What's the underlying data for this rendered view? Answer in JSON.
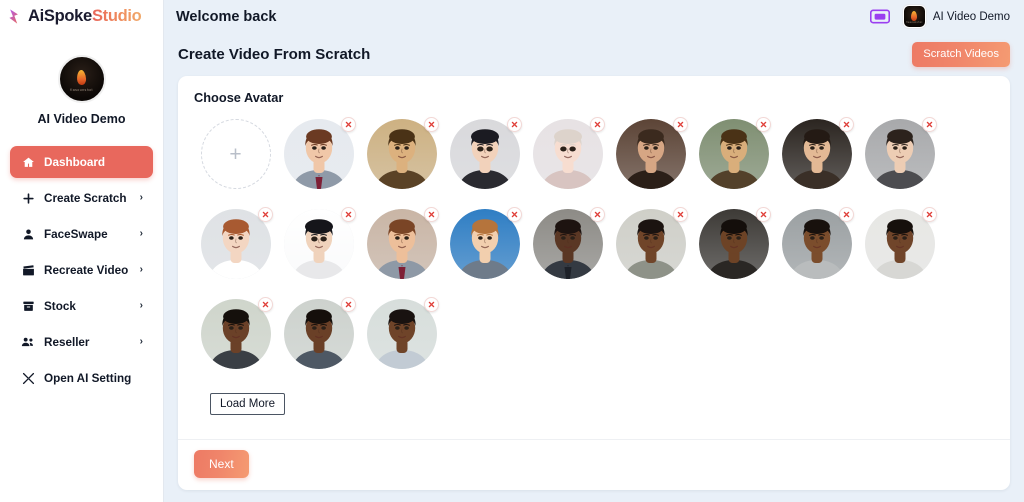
{
  "brand": {
    "ai": "Ai",
    "spoke": "Spoke",
    "studio": "Studio",
    "logo_icon": "play-bolt-icon"
  },
  "sidebar": {
    "profile": {
      "name": "AI Video Demo",
      "avatar_icon": "flame-avatar",
      "avatar_caption": "flasounshot"
    },
    "items": [
      {
        "label": "Dashboard",
        "icon": "home-icon",
        "active": true,
        "chevron": ""
      },
      {
        "label": "Create Scratch",
        "icon": "plus-icon",
        "active": false,
        "chevron": "›"
      },
      {
        "label": "FaceSwape",
        "icon": "person-icon",
        "active": false,
        "chevron": "›"
      },
      {
        "label": "Recreate Video",
        "icon": "film-clap-icon",
        "active": false,
        "chevron": "›"
      },
      {
        "label": "Stock",
        "icon": "archive-icon",
        "active": false,
        "chevron": "›"
      },
      {
        "label": "Reseller",
        "icon": "users-icon",
        "active": false,
        "chevron": "›"
      },
      {
        "label": "Open AI Setting",
        "icon": "tools-icon",
        "active": false,
        "chevron": ""
      }
    ]
  },
  "topbar": {
    "welcome": "Welcome back",
    "credit_icon": "video-card-icon",
    "user_name": "AI Video Demo",
    "user_avatar_icon": "flame-avatar",
    "user_avatar_caption": "flasounshot"
  },
  "page": {
    "title": "Create Video From Scratch",
    "scratch_button": "Scratch Videos"
  },
  "avatar_panel": {
    "heading": "Choose Avatar",
    "add_icon": "plus-icon",
    "delete_icon": "close-x-icon",
    "load_more": "Load More",
    "next": "Next",
    "avatars": [
      {
        "name": "avatar-animated-man-suit",
        "skin": "#f0c7a8",
        "hair": "#6b3a22",
        "bg": "#e6eaef",
        "shirt": "#8f9aa8",
        "tie": "#7e1f35",
        "style": "cartoon"
      },
      {
        "name": "avatar-mona-lisa",
        "skin": "#dcb17e",
        "hair": "#4a3216",
        "bg": "#cdb182",
        "shirt": "#5a4226",
        "tie": "",
        "style": "painting"
      },
      {
        "name": "avatar-anime-dark-hair-man",
        "skin": "#f2d2bb",
        "hair": "#1b1b22",
        "bg": "#d9d9dc",
        "shirt": "#2a2a30",
        "tie": "",
        "style": "anime"
      },
      {
        "name": "avatar-anime-blonde-woman",
        "skin": "#f7ddd0",
        "hair": "#ddd3cb",
        "bg": "#e7e2e4",
        "shirt": "#d8c4c1",
        "tie": "",
        "style": "anime"
      },
      {
        "name": "avatar-shakespeare-portrait",
        "skin": "#d6a684",
        "hair": "#3b2a1e",
        "bg": "#5c4436",
        "shirt": "#2b1f18",
        "tie": "",
        "style": "painting"
      },
      {
        "name": "avatar-mona-lisa-2",
        "skin": "#d9ae7b",
        "hair": "#4a3216",
        "bg": "#7f8f72",
        "shirt": "#53412a",
        "tie": "",
        "style": "painting"
      },
      {
        "name": "avatar-glasses-man-dark",
        "skin": "#e3b995",
        "hair": "#241a14",
        "bg": "#2b2520",
        "shirt": "#3a2f27",
        "tie": "",
        "style": "photo"
      },
      {
        "name": "avatar-young-man-grey-bg",
        "skin": "#edcdb4",
        "hair": "#2c221c",
        "bg": "#a8a9ab",
        "shirt": "#4c4c50",
        "tie": "",
        "style": "photo"
      },
      {
        "name": "avatar-redhead-woman",
        "skin": "#f3d6c2",
        "hair": "#a85a31",
        "bg": "#dfe2e5",
        "shirt": "#ffffff",
        "tie": "",
        "style": "photo"
      },
      {
        "name": "avatar-anime-man-black-hair",
        "skin": "#f0d3bc",
        "hair": "#15151a",
        "bg": "#ffffff",
        "shirt": "#e8e8ea",
        "tie": "",
        "style": "anime"
      },
      {
        "name": "avatar-cartoon-boy-suit",
        "skin": "#edbf9a",
        "hair": "#7a4526",
        "bg": "#c9b5a5",
        "shirt": "#8e99a6",
        "tie": "#7e1f35",
        "style": "cartoon"
      },
      {
        "name": "avatar-cartoon-boy-blue-bg",
        "skin": "#f2cfae",
        "hair": "#b5743c",
        "bg": "#2f7ec4",
        "shirt": "#6e7b8a",
        "tie": "",
        "style": "cartoon"
      },
      {
        "name": "avatar-man-on-phone-suit",
        "skin": "#5a3724",
        "hair": "#1d1310",
        "bg": "#8d8b86",
        "shirt": "#343a42",
        "tie": "#1d2128",
        "style": "photo"
      },
      {
        "name": "avatar-young-man-jacket",
        "skin": "#704529",
        "hair": "#1b1310",
        "bg": "#cfcfc8",
        "shirt": "#8e9288",
        "tie": "",
        "style": "photo"
      },
      {
        "name": "avatar-smiling-man-dark-bg",
        "skin": "#6d4326",
        "hair": "#140e0b",
        "bg": "#3d3a36",
        "shirt": "#2a2724",
        "tie": "",
        "style": "photo"
      },
      {
        "name": "avatar-man-grey-sweater",
        "skin": "#7b4d2c",
        "hair": "#18110d",
        "bg": "#9ba0a2",
        "shirt": "#b9bcbd",
        "tie": "",
        "style": "photo"
      },
      {
        "name": "avatar-man-white-bg-smile",
        "skin": "#70452a",
        "hair": "#16100c",
        "bg": "#e7e7e4",
        "shirt": "#d7d7d4",
        "tie": "",
        "style": "photo"
      },
      {
        "name": "avatar-man-green-bg-smile",
        "skin": "#6b4128",
        "hair": "#15100c",
        "bg": "#cfd5cb",
        "shirt": "#3a3f45",
        "tie": "",
        "style": "photo"
      },
      {
        "name": "avatar-man-phone-tshirt",
        "skin": "#6a4027",
        "hair": "#150f0b",
        "bg": "#cdd2cd",
        "shirt": "#4e5864",
        "tie": "",
        "style": "photo"
      },
      {
        "name": "avatar-man-shirt-light-bg",
        "skin": "#6f4429",
        "hair": "#191210",
        "bg": "#d7dedb",
        "shirt": "#c2cbd4",
        "tie": "",
        "style": "photo"
      }
    ]
  }
}
